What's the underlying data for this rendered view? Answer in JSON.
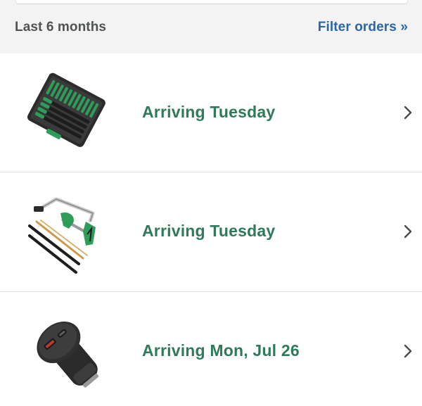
{
  "header": {
    "period_label": "Last 6 months",
    "filter_label": "Filter orders »"
  },
  "orders": [
    {
      "status": "Arriving Tuesday",
      "image": "screwdriver-set-case",
      "icon": "chevron-right-icon"
    },
    {
      "status": "Arriving Tuesday",
      "image": "hacksaw-with-blades",
      "icon": "chevron-right-icon"
    },
    {
      "status": "Arriving Mon, Jul 26",
      "image": "usb-car-charger",
      "icon": "chevron-right-icon"
    }
  ],
  "colors": {
    "status_green": "#2e7a5b",
    "link_blue": "#2a67a7",
    "label_gray": "#4f5354",
    "header_bg": "#f3f3f3"
  }
}
